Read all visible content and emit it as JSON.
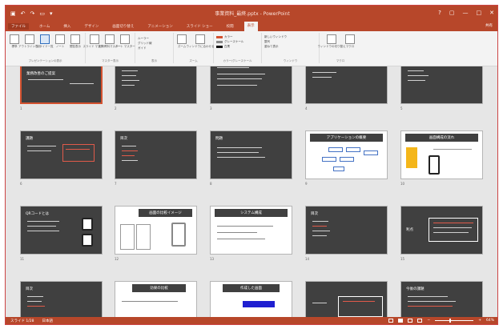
{
  "window": {
    "title": "事業資料_最終.pptx - PowerPoint"
  },
  "qat": {
    "items": [
      "save-icon",
      "undo-icon",
      "redo-icon",
      "present-icon",
      "customize-icon"
    ]
  },
  "window_controls": [
    "?",
    "▢",
    "—",
    "□",
    "✕"
  ],
  "tabs": [
    {
      "label": "ファイル",
      "id": "file"
    },
    {
      "label": "ホーム",
      "id": "home"
    },
    {
      "label": "挿入",
      "id": "insert"
    },
    {
      "label": "デザイン",
      "id": "design"
    },
    {
      "label": "画面切り替え",
      "id": "transitions"
    },
    {
      "label": "アニメーション",
      "id": "animations"
    },
    {
      "label": "スライド ショー",
      "id": "slideshow"
    },
    {
      "label": "校閲",
      "id": "review"
    },
    {
      "label": "表示",
      "id": "view"
    }
  ],
  "share_label": "共有",
  "ribbon": {
    "groups": [
      {
        "label": "プレゼンテーションの表示",
        "buttons": [
          "標準",
          "アウトライン表示",
          "スライド一覧",
          "ノート",
          "閲覧表示"
        ]
      },
      {
        "label": "マスター表示",
        "buttons": [
          "スライド マスター",
          "配布資料マスター",
          "ノート マスター"
        ]
      },
      {
        "label": "表示",
        "buttons": [
          "ルーラー",
          "グリッド線",
          "ガイド"
        ]
      },
      {
        "label": "ズーム",
        "buttons": [
          "ズーム",
          "ウィンドウに合わせる"
        ]
      },
      {
        "label": "カラー/グレースケール",
        "items": [
          "カラー",
          "グレースケール",
          "白黒"
        ]
      },
      {
        "label": "ウィンドウ",
        "items": [
          "新しいウィンドウ",
          "整列",
          "重ねて表示"
        ]
      },
      {
        "label": "マクロ",
        "buttons": [
          "ウィンドウの切り替え",
          "マクロ"
        ]
      }
    ]
  },
  "slides": [
    {
      "num": "1",
      "title": "業務改善のご提案",
      "style": "dark",
      "selected": true
    },
    {
      "num": "2",
      "title": "目次",
      "style": "dark"
    },
    {
      "num": "3",
      "title": "概要",
      "style": "dark"
    },
    {
      "num": "4",
      "title": "",
      "style": "dark"
    },
    {
      "num": "5",
      "title": "",
      "style": "dark"
    },
    {
      "num": "6",
      "title": "課題",
      "style": "dark"
    },
    {
      "num": "7",
      "title": "目次",
      "style": "dark"
    },
    {
      "num": "8",
      "title": "問題",
      "style": "dark"
    },
    {
      "num": "9",
      "title": "アプリケーションの概要",
      "style": "light"
    },
    {
      "num": "10",
      "title": "画面構成の流れ",
      "style": "light"
    },
    {
      "num": "11",
      "title": "QRコードとは",
      "style": "dark"
    },
    {
      "num": "12",
      "title": "画面の比較イメージ",
      "style": "light"
    },
    {
      "num": "13",
      "title": "システム構成",
      "style": "light"
    },
    {
      "num": "14",
      "title": "目次",
      "style": "dark"
    },
    {
      "num": "15",
      "title": "利点",
      "style": "dark"
    },
    {
      "num": "16",
      "title": "目次",
      "style": "dark"
    },
    {
      "num": "17",
      "title": "効果の比較",
      "style": "light"
    },
    {
      "num": "18",
      "title": "作成した画面",
      "style": "light"
    },
    {
      "num": "19",
      "title": "",
      "style": "dark"
    },
    {
      "num": "20",
      "title": "今後の課題",
      "style": "dark"
    }
  ],
  "status": {
    "slide_info": "スライド 1/28",
    "language": "日本語",
    "zoom": "64%"
  },
  "colors": {
    "accent": "#b7472a",
    "slide_dark": "#404040",
    "highlight": "#e05a4a"
  }
}
